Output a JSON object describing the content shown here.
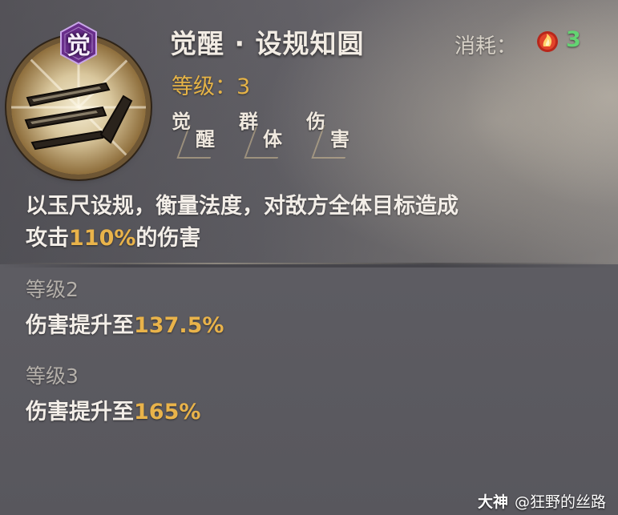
{
  "skill": {
    "icon": "jade-ruler-icon",
    "awaken_badge": "觉",
    "title": "觉醒 · 设规知圆",
    "level_label": "等级：3",
    "cost_label": "消耗：",
    "cost_icon": "flame-orb-icon",
    "cost_value": "3",
    "tags": [
      {
        "c1": "觉",
        "c2": "醒"
      },
      {
        "c1": "群",
        "c2": "体"
      },
      {
        "c1": "伤",
        "c2": "害"
      }
    ],
    "description": {
      "line1": "以玉尺设规，衡量法度，对敌方全体目标造成",
      "line2_pre": "攻击",
      "line2_value": "110%",
      "line2_post": "的伤害"
    }
  },
  "upgrades": [
    {
      "heading": "等级2",
      "text": "伤害提升至",
      "value": "137.5%"
    },
    {
      "heading": "等级3",
      "text": "伤害提升至",
      "value": "165%"
    }
  ],
  "watermark": {
    "brand": "大神",
    "handle": "@狂野的丝路"
  },
  "colors": {
    "highlight": "#e9b34a",
    "cost_green": "#63d472",
    "awaken_purple": "#6a2e8c"
  }
}
